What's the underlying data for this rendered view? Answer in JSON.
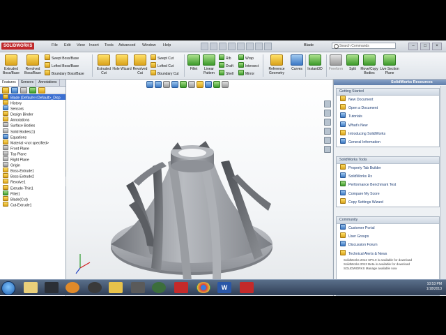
{
  "app": {
    "logo_text": "SOLIDWORKS",
    "menus": [
      "File",
      "Edit",
      "View",
      "Insert",
      "Tools",
      "Advanced",
      "Window",
      "Help"
    ],
    "document_title": "Blade",
    "search_placeholder": "Search Commands"
  },
  "ribbon": {
    "big_buttons": [
      {
        "label": "Extruded Boss/Base",
        "icon": "extrude-icon",
        "color": "y"
      },
      {
        "label": "Revolved Boss/Base",
        "icon": "revolve-icon",
        "color": "y"
      },
      {
        "label": "Extruded Cut",
        "icon": "extruded-cut-icon",
        "color": "y"
      },
      {
        "label": "Hole Wizard",
        "icon": "hole-wizard-icon",
        "color": "y"
      },
      {
        "label": "Revolved Cut",
        "icon": "revolved-cut-icon",
        "color": "y"
      },
      {
        "label": "Fillet",
        "icon": "fillet-icon",
        "color": "g"
      },
      {
        "label": "Linear Pattern",
        "icon": "linear-pattern-icon",
        "color": "g"
      },
      {
        "label": "Reference Geometry",
        "icon": "reference-geometry-icon",
        "color": "y"
      },
      {
        "label": "Curves",
        "icon": "curves-icon",
        "color": "b"
      },
      {
        "label": "Instant3D",
        "icon": "instant3d-icon",
        "color": "g"
      },
      {
        "label": "Freeform",
        "icon": "freeform-icon",
        "color": "gr"
      },
      {
        "label": "Split",
        "icon": "split-icon",
        "color": "g"
      },
      {
        "label": "Move/Copy Bodies",
        "icon": "move-copy-icon",
        "color": "g"
      },
      {
        "label": "Live Section Plane",
        "icon": "section-plane-icon",
        "color": "g"
      }
    ],
    "small_group_1": [
      "Swept Boss/Base",
      "Lofted Boss/Base",
      "Boundary Boss/Base"
    ],
    "small_group_2": [
      "Swept Cut",
      "Lofted Cut",
      "Boundary Cut"
    ],
    "small_group_3": [
      "Rib",
      "Draft",
      "Shell"
    ],
    "small_group_4": [
      "Wrap",
      "Intersect",
      "Mirror"
    ]
  },
  "left_panel": {
    "tabs": [
      "Features",
      "Sensors",
      "Annotations"
    ],
    "tree": [
      "Blade (Default<<Default>_Disp",
      "History",
      "Sensors",
      "Design Binder",
      "Annotations",
      "Surface Bodies",
      "Solid Bodies(1)",
      "Equations",
      "Material <not specified>",
      "Front Plane",
      "Top Plane",
      "Right Plane",
      "Origin",
      "Boss-Extrude1",
      "Boss-Extrude2",
      "Revolve1",
      "Extrude-Thin1",
      "Fillet1",
      "Blade(Cut)",
      "Cut-Extrude1"
    ]
  },
  "task_pane": {
    "title": "SolidWorks Resources",
    "groups": [
      {
        "title": "Getting Started",
        "items": [
          "New Document",
          "Open a Document",
          "Tutorials",
          "What's New",
          "Introducing SolidWorks",
          "General Information"
        ]
      },
      {
        "title": "SolidWorks Tools",
        "items": [
          "Property Tab Builder",
          "SolidWorks Rx",
          "Performance Benchmark Test",
          "Compare My Score",
          "Copy Settings Wizard"
        ]
      },
      {
        "title": "Community",
        "items": [
          "Customer Portal",
          "User Groups",
          "Discussion Forum",
          "Technical Alerts & News"
        ]
      }
    ],
    "news": [
      "SolidWorks 2012 SP5.0 is available for download",
      "SolidWorks 2013 Beta is available for download",
      "SOLIDWORKS Manage available now"
    ]
  },
  "taskbar": {
    "time": "10:53 PM",
    "date": "1/18/2013"
  }
}
